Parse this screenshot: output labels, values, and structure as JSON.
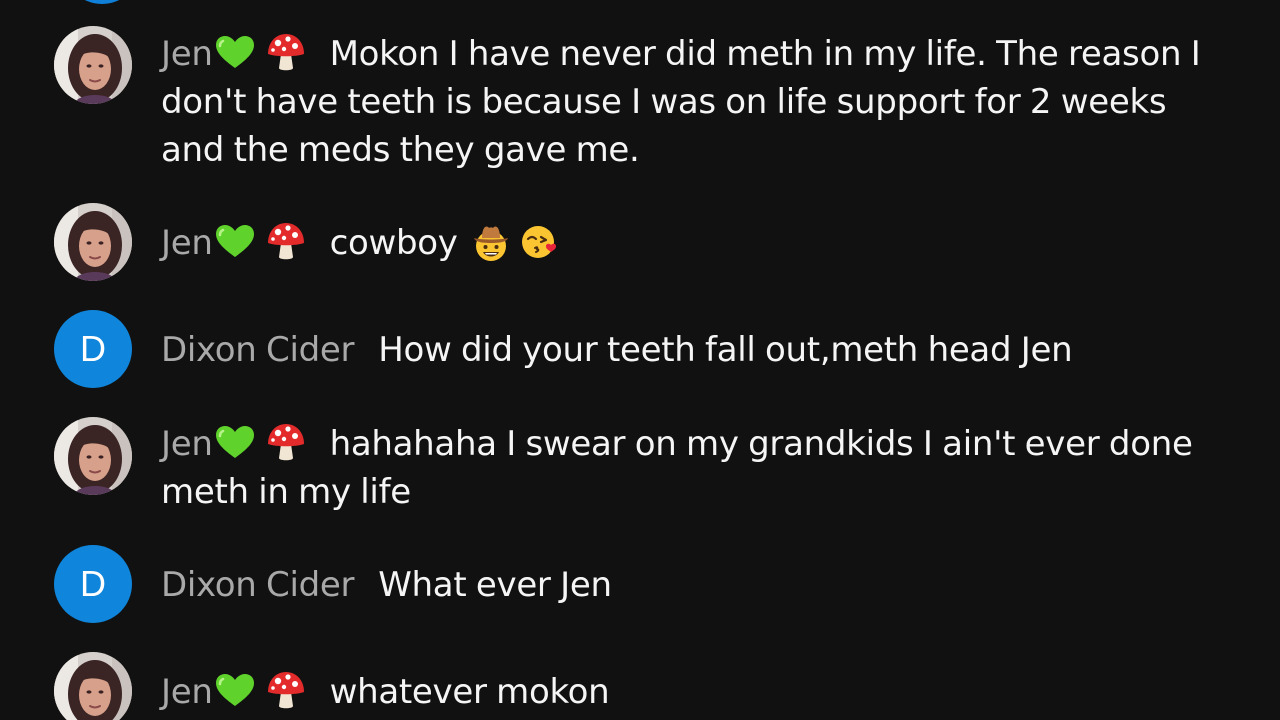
{
  "messages": [
    {
      "author": "Jen",
      "avatar": "photo",
      "author_emojis": [
        "green-heart-icon",
        "mushroom-icon"
      ],
      "text": "Mokon I have never did meth in my life. The reason I don't have teeth is because I was on life support for 2 weeks and the meds they gave me.",
      "text_emojis": []
    },
    {
      "author": "Jen",
      "avatar": "photo",
      "author_emojis": [
        "green-heart-icon",
        "mushroom-icon"
      ],
      "text": "cowboy",
      "text_emojis": [
        "cowboy-face-icon",
        "face-blowing-kiss-icon"
      ]
    },
    {
      "author": "Dixon Cider",
      "avatar": "letter",
      "avatar_letter": "D",
      "author_emojis": [],
      "text": "How did your teeth fall out,meth head Jen",
      "text_emojis": []
    },
    {
      "author": "Jen",
      "avatar": "photo",
      "author_emojis": [
        "green-heart-icon",
        "mushroom-icon"
      ],
      "text": "hahahaha I swear on my grandkids I ain't ever done meth in my life",
      "text_emojis": []
    },
    {
      "author": "Dixon Cider",
      "avatar": "letter",
      "avatar_letter": "D",
      "author_emojis": [],
      "text": "What ever Jen",
      "text_emojis": []
    },
    {
      "author": "Jen",
      "avatar": "photo",
      "author_emojis": [
        "green-heart-icon",
        "mushroom-icon"
      ],
      "text": "whatever mokon",
      "text_emojis": []
    }
  ],
  "colors": {
    "background": "#111111",
    "author_name": "#a9a9a9",
    "message_text": "#f5f5f5",
    "letter_avatar": "#0f85db"
  }
}
